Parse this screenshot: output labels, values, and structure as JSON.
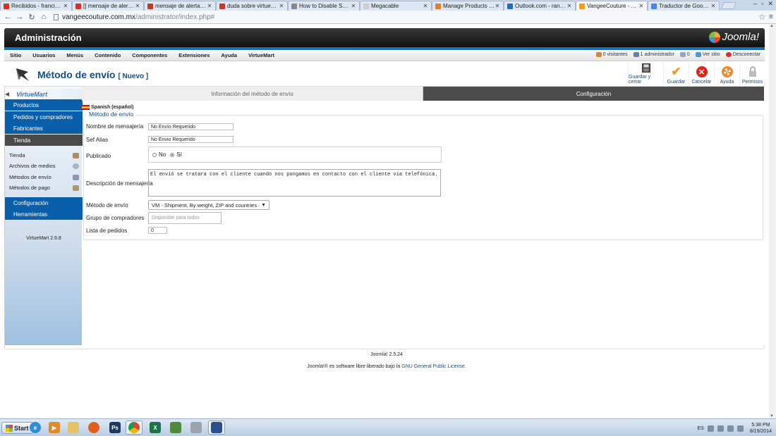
{
  "browser": {
    "tabs": [
      {
        "label": "Recibidos - francisco.lu",
        "color": "#d93025"
      },
      {
        "label": "[] mensaje de alerta al m",
        "color": "#d93025"
      },
      {
        "label": "mensaje de alerta al m",
        "color": "#c0392b"
      },
      {
        "label": "duda sobre virtuemart",
        "color": "#c0392b"
      },
      {
        "label": "How to Disable Shippin",
        "color": "#888888"
      },
      {
        "label": "Megacable",
        "color": "#cccccc"
      },
      {
        "label": "Manage Products / Cat",
        "color": "#e67e22"
      },
      {
        "label": "Outlook.com - randall",
        "color": "#1f6fb3"
      },
      {
        "label": "VangeeCouture - Admi",
        "color": "#f39c12"
      },
      {
        "label": "Traductor de Google",
        "color": "#4285f4"
      }
    ],
    "url_host": "vangeecouture.com.mx",
    "url_path": "/administrator/index.php#"
  },
  "admin": {
    "title": "Administración",
    "logo": "Joomla!",
    "menu": [
      "Sitio",
      "Usuarios",
      "Menús",
      "Contenido",
      "Componentes",
      "Extensiones",
      "Ayuda",
      "VirtueMart"
    ],
    "status": {
      "visitors": "0 visitantes",
      "admins": "1 administrador",
      "messages": "0",
      "view_site": "Ver sitio",
      "logout": "Desconectar"
    }
  },
  "toolbar": {
    "title": "Método de envío",
    "subtitle": "[ Nuevo ]",
    "buttons": [
      {
        "label": "Guardar y cerrar",
        "icon": "save-close-icon"
      },
      {
        "label": "Guardar",
        "icon": "check-icon"
      },
      {
        "label": "Cancelar",
        "icon": "cancel-icon"
      },
      {
        "label": "Ayuda",
        "icon": "help-icon"
      },
      {
        "label": "Permisos",
        "icon": "lock-icon"
      }
    ]
  },
  "sidebar": {
    "logo": "VirtueMart",
    "sections": {
      "productos": "Productos",
      "pedidos": "Pedidos y compradores",
      "fabricantes": "Fabricantes",
      "tienda": "Tienda",
      "configuracion": "Configuración",
      "herramientas": "Herramientas"
    },
    "tienda_items": [
      "Tienda",
      "Archivos de medios",
      "Métodos de envío",
      "Métodos de pago"
    ],
    "version": "VirtueMart 2.6.8"
  },
  "content": {
    "tabs": [
      "Información del método de envío",
      "Configuración"
    ],
    "language": "Spanish (español)",
    "legend": "Método de envío",
    "fields": {
      "name_label": "Nombre de mensajería",
      "name_value": "No Envío Requerido",
      "alias_label": "Sef Alias",
      "alias_value": "No Envio Requerido",
      "published_label": "Publicado",
      "published_no": "No",
      "published_yes": "Sí",
      "description_label": "Descripción de mensajería",
      "description_value": "El envió se tratara con el cliente cuando nos pongamos en contacto con el cliente via telefónica.",
      "method_label": "Método de envío",
      "method_value": "VM - Shipment, By weight, ZIP and countries",
      "group_label": "Grupo de compradores",
      "group_placeholder": "Disponible para todos",
      "order_label": "Lista de pedidos",
      "order_value": "0"
    }
  },
  "footer": {
    "version": "Joomla! 2.5.24",
    "license_prefix": "Joomla!® es software libre liberado bajo la",
    "license_link": "GNU General Public License."
  },
  "taskbar": {
    "start": "Start",
    "language": "ES",
    "time": "5:38 PM",
    "date": "8/19/2014"
  }
}
